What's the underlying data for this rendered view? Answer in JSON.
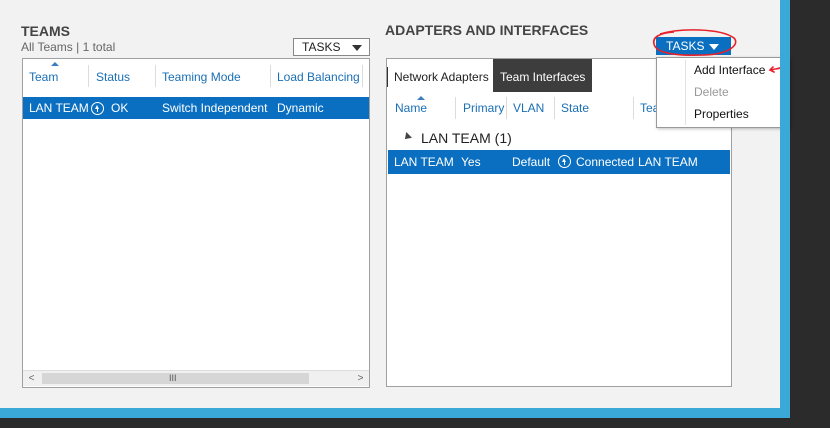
{
  "teams": {
    "title": "TEAMS",
    "subtitle": "All Teams | 1 total",
    "tasks_label": "TASKS",
    "columns": [
      "Team",
      "Status",
      "Teaming Mode",
      "Load Balancing"
    ],
    "rows": [
      {
        "team": "LAN TEAM",
        "status": "OK",
        "teaming_mode": "Switch Independent",
        "load_balancing": "Dynamic"
      }
    ],
    "scrollbar": {
      "left": "<",
      "right": ">",
      "grip": "III"
    }
  },
  "adapters": {
    "title": "ADAPTERS AND INTERFACES",
    "tasks_label": "TASKS",
    "tabs": [
      "Network Adapters",
      "Team Interfaces"
    ],
    "columns": [
      "Name",
      "Primary",
      "VLAN",
      "State",
      "Tea"
    ],
    "group_label": "LAN TEAM (1)",
    "rows": [
      {
        "name": "LAN TEAM",
        "primary": "Yes",
        "vlan": "Default",
        "state": "Connected",
        "team": "LAN TEAM"
      }
    ],
    "menu": [
      {
        "label": "Add Interface",
        "enabled": true
      },
      {
        "label": "Delete",
        "enabled": false
      },
      {
        "label": "Properties",
        "enabled": true
      }
    ]
  },
  "colors": {
    "selection": "#0a6fc0",
    "header_text": "#1a6fb5",
    "border_cyan": "#3aa9d8",
    "annotation": "#e8202a"
  }
}
